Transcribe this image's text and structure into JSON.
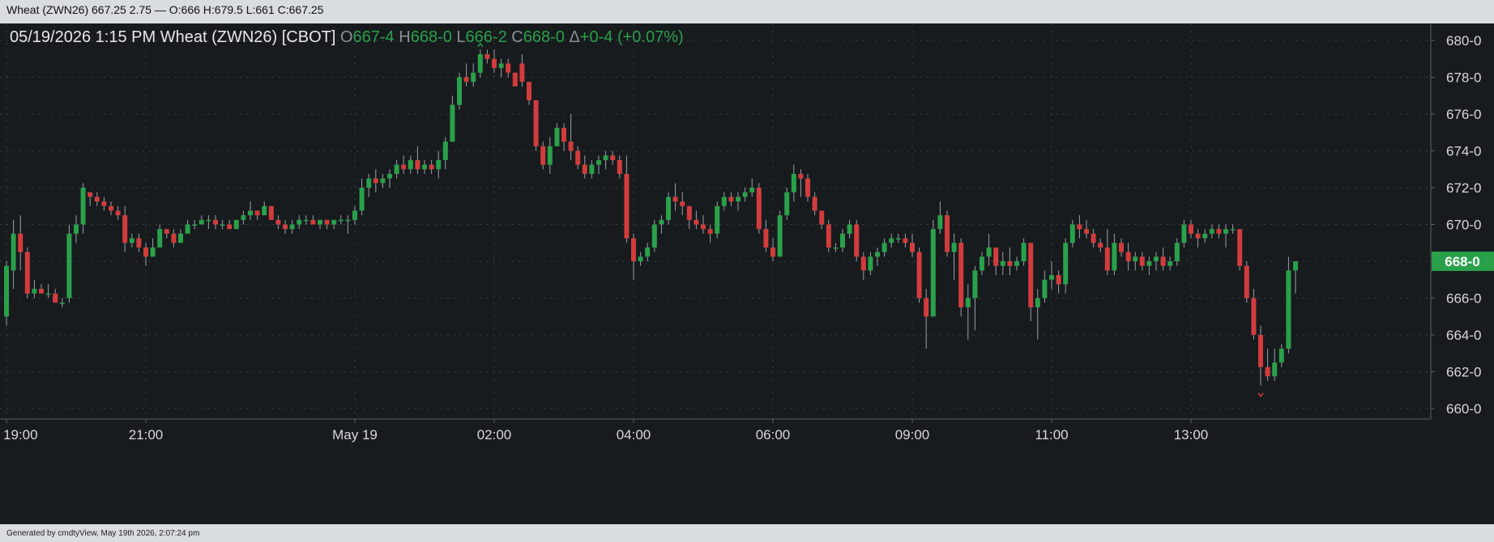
{
  "window": {
    "title": "Wheat (ZWN26) 667.25 2.75 — O:666 H:679.5 L:661 C:667.25"
  },
  "header": {
    "datetime": "05/19/2026  1:15 PM",
    "instrument": "Wheat (ZWN26) [CBOT]",
    "open_label": "O",
    "open_value": "667-4",
    "high_label": "H",
    "high_value": "668-0",
    "low_label": "L",
    "low_value": "666-2",
    "close_label": "C",
    "close_value": "668-0",
    "change_label": "Δ",
    "change_value": "+0-4 (+0.07%)"
  },
  "footer": {
    "text": "Generated by cmdtyView, May 19th 2026, 2:07:24 pm"
  },
  "colors": {
    "background": "#171b1e",
    "up": "#2aa04a",
    "down": "#d23c3c",
    "grid": "#3a3f44",
    "last_price_tag": "#2aa04a"
  },
  "chart_data": {
    "type": "candlestick",
    "title": "Wheat (ZWN26) [CBOT]",
    "interval": "15 min",
    "ylim": [
      659.5,
      681
    ],
    "y_ticks": [
      "680-0",
      "678-0",
      "676-0",
      "674-0",
      "672-0",
      "670-0",
      "668-0",
      "666-0",
      "664-0",
      "662-0",
      "660-0"
    ],
    "y_tick_values": [
      680,
      678,
      676,
      674,
      672,
      670,
      668,
      666,
      664,
      662,
      660
    ],
    "x_ticks": [
      "19:00",
      "21:00",
      "May 19",
      "02:00",
      "04:00",
      "06:00",
      "09:00",
      "11:00",
      "13:00"
    ],
    "x_tick_positions": [
      0,
      20,
      50,
      70,
      90,
      110,
      130,
      150,
      170
    ],
    "grid": true,
    "last_price": "668-0",
    "last_price_value": 668,
    "high_marker": 679.75,
    "low_marker": 660.75,
    "candles": [
      [
        665,
        668,
        664.5,
        667.75
      ],
      [
        667.5,
        670.25,
        666.5,
        669.5
      ],
      [
        669.5,
        670.5,
        667.5,
        668.5
      ],
      [
        668.5,
        668.75,
        666,
        666.25
      ],
      [
        666.25,
        667,
        666,
        666.5
      ],
      [
        666.5,
        666.75,
        666.25,
        666.25
      ],
      [
        666.25,
        666.75,
        666,
        666.25
      ],
      [
        666.25,
        666.5,
        665.75,
        665.75
      ],
      [
        665.75,
        666,
        665.5,
        665.75
      ],
      [
        666,
        670,
        665.75,
        669.5
      ],
      [
        669.5,
        670.5,
        669,
        670
      ],
      [
        670,
        672.25,
        669.5,
        672
      ],
      [
        671.75,
        671.75,
        671,
        671.5
      ],
      [
        671.5,
        671.75,
        671,
        671.25
      ],
      [
        671.25,
        671.5,
        670.75,
        671
      ],
      [
        671,
        671.25,
        670.5,
        670.75
      ],
      [
        670.75,
        671,
        670.25,
        670.5
      ],
      [
        670.5,
        671,
        668.5,
        669
      ],
      [
        669,
        669.5,
        668.75,
        669.25
      ],
      [
        669.25,
        669.5,
        668.5,
        668.75
      ],
      [
        668.75,
        669,
        667.75,
        668.25
      ],
      [
        668.25,
        669.25,
        668.25,
        668.75
      ],
      [
        668.75,
        670,
        668.75,
        669.75
      ],
      [
        669.75,
        669.75,
        669.25,
        669.5
      ],
      [
        669.5,
        669.75,
        668.75,
        669
      ],
      [
        669,
        669.75,
        669,
        669.5
      ],
      [
        669.5,
        670.25,
        669.5,
        670
      ],
      [
        670,
        670.25,
        669.75,
        670
      ],
      [
        670,
        670.5,
        670,
        670.25
      ],
      [
        670.25,
        670.5,
        669.75,
        670.25
      ],
      [
        670.25,
        670.5,
        669.75,
        670
      ],
      [
        670,
        670.25,
        669.75,
        670
      ],
      [
        670,
        670.25,
        669.75,
        669.75
      ],
      [
        669.75,
        670.25,
        669.75,
        670.25
      ],
      [
        670.25,
        670.75,
        670,
        670.5
      ],
      [
        670.5,
        671.25,
        670.25,
        670.75
      ],
      [
        670.75,
        670.75,
        670.25,
        670.5
      ],
      [
        670.5,
        671.25,
        670.5,
        671
      ],
      [
        671,
        671,
        670.25,
        670.25
      ],
      [
        670.25,
        670.5,
        669.75,
        670
      ],
      [
        670,
        670.25,
        669.5,
        669.75
      ],
      [
        669.75,
        670.25,
        669.5,
        670
      ],
      [
        670,
        670.5,
        669.75,
        670.25
      ],
      [
        670.25,
        670.5,
        670,
        670.25
      ],
      [
        670.25,
        670.5,
        670,
        670
      ],
      [
        670,
        670.25,
        669.75,
        670.25
      ],
      [
        670.25,
        670.25,
        669.75,
        670
      ],
      [
        670,
        670.25,
        669.75,
        670.25
      ],
      [
        670.25,
        670.5,
        670,
        670.25
      ],
      [
        670.25,
        670.5,
        669.5,
        670.25
      ],
      [
        670.25,
        671,
        670,
        670.75
      ],
      [
        670.75,
        672.5,
        670.5,
        672
      ],
      [
        672,
        672.75,
        671.5,
        672.5
      ],
      [
        672.5,
        673,
        671.75,
        672.25
      ],
      [
        672.25,
        672.75,
        672,
        672.5
      ],
      [
        672.5,
        673,
        672,
        672.75
      ],
      [
        672.75,
        673.5,
        672.5,
        673.25
      ],
      [
        673.25,
        673.75,
        672.75,
        673
      ],
      [
        673,
        673.75,
        672.75,
        673.5
      ],
      [
        673.5,
        674.25,
        672.75,
        673
      ],
      [
        673,
        673.5,
        672.75,
        673.25
      ],
      [
        673.25,
        673.5,
        672.75,
        673
      ],
      [
        673,
        674,
        672.5,
        673.5
      ],
      [
        673.5,
        674.75,
        673,
        674.5
      ],
      [
        674.5,
        677,
        674.5,
        676.5
      ],
      [
        676.5,
        678.25,
        676.25,
        678
      ],
      [
        678,
        678.75,
        677.5,
        677.75
      ],
      [
        677.75,
        678.75,
        677.5,
        678.25
      ],
      [
        678.25,
        679.5,
        678,
        679.25
      ],
      [
        679.25,
        679.5,
        678.75,
        679
      ],
      [
        679,
        679.5,
        678.25,
        678.5
      ],
      [
        678.5,
        679,
        678,
        678.75
      ],
      [
        678.75,
        679,
        678,
        678.25
      ],
      [
        678.25,
        678.25,
        677.5,
        677.5
      ],
      [
        678.75,
        679.25,
        677.5,
        677.75
      ],
      [
        677.75,
        677.75,
        676.5,
        676.75
      ],
      [
        676.75,
        676.75,
        674,
        674.25
      ],
      [
        674.25,
        674.5,
        673,
        673.25
      ],
      [
        673.25,
        674.75,
        672.75,
        674.25
      ],
      [
        674.25,
        675.5,
        674.25,
        675.25
      ],
      [
        675.25,
        675.5,
        674,
        674.5
      ],
      [
        674.5,
        676,
        673.5,
        674
      ],
      [
        674,
        674.25,
        673,
        673.25
      ],
      [
        673.25,
        673.75,
        672.5,
        672.75
      ],
      [
        672.75,
        673.5,
        672.5,
        673.25
      ],
      [
        673.25,
        673.75,
        672.75,
        673.5
      ],
      [
        673.5,
        674,
        673,
        673.75
      ],
      [
        673.75,
        674,
        673.25,
        673.5
      ],
      [
        673.5,
        673.75,
        672.5,
        672.75
      ],
      [
        672.75,
        673.75,
        669,
        669.25
      ],
      [
        669.25,
        669.5,
        667,
        668
      ],
      [
        668,
        668.5,
        667.75,
        668.25
      ],
      [
        668.25,
        669,
        668,
        668.75
      ],
      [
        668.75,
        670.25,
        668.5,
        670
      ],
      [
        670,
        670.5,
        669.5,
        670.25
      ],
      [
        670.25,
        671.75,
        670,
        671.5
      ],
      [
        671.5,
        672.25,
        670.75,
        671.25
      ],
      [
        671.25,
        671.75,
        670.5,
        671
      ],
      [
        671,
        671,
        669.75,
        670.25
      ],
      [
        670.25,
        670.75,
        669.75,
        670
      ],
      [
        670,
        670.5,
        669.5,
        669.75
      ],
      [
        669.75,
        670,
        669,
        669.5
      ],
      [
        669.5,
        671.25,
        669.25,
        671
      ],
      [
        671,
        671.75,
        670.75,
        671.5
      ],
      [
        671.5,
        671.75,
        671,
        671.25
      ],
      [
        671.25,
        671.75,
        670.75,
        671.5
      ],
      [
        671.5,
        672,
        671.25,
        671.75
      ],
      [
        671.75,
        672.5,
        671.5,
        672
      ],
      [
        672,
        672.25,
        669.5,
        669.75
      ],
      [
        669.75,
        670.25,
        668.5,
        668.75
      ],
      [
        668.75,
        669.25,
        668,
        668.25
      ],
      [
        668.25,
        670.75,
        668.25,
        670.5
      ],
      [
        670.5,
        672,
        670.25,
        671.75
      ],
      [
        671.75,
        673.25,
        671.25,
        672.75
      ],
      [
        672.75,
        673,
        671.5,
        672.5
      ],
      [
        672.5,
        672.75,
        671.25,
        671.5
      ],
      [
        671.5,
        671.75,
        670.5,
        670.75
      ],
      [
        670.75,
        670.75,
        669.75,
        670
      ],
      [
        670,
        670.25,
        668.5,
        668.75
      ],
      [
        668.75,
        669,
        668.5,
        668.75
      ],
      [
        668.75,
        669.75,
        668.5,
        669.5
      ],
      [
        669.5,
        670.25,
        669.25,
        670
      ],
      [
        670,
        670.25,
        668,
        668.25
      ],
      [
        668.25,
        668.5,
        667,
        667.5
      ],
      [
        667.5,
        668.5,
        667.25,
        668.25
      ],
      [
        668.25,
        668.75,
        667.75,
        668.5
      ],
      [
        668.5,
        669.25,
        668.25,
        669
      ],
      [
        669,
        669.5,
        668.75,
        669.25
      ],
      [
        669.25,
        669.5,
        669,
        669.25
      ],
      [
        669.25,
        669.5,
        668.75,
        669
      ],
      [
        669,
        669.5,
        668.25,
        668.5
      ],
      [
        668.5,
        668.75,
        665.75,
        666
      ],
      [
        666,
        666.5,
        663.25,
        665
      ],
      [
        665,
        670.25,
        665,
        669.75
      ],
      [
        669.75,
        671.25,
        669.5,
        670.5
      ],
      [
        670.5,
        670.75,
        668.25,
        668.5
      ],
      [
        668.5,
        669.5,
        667,
        669
      ],
      [
        669,
        669.25,
        665,
        665.5
      ],
      [
        665.5,
        666.75,
        663.75,
        666
      ],
      [
        666,
        667.75,
        664.25,
        667.5
      ],
      [
        667.5,
        668.5,
        667.25,
        668.25
      ],
      [
        668.25,
        669.5,
        667.75,
        668.75
      ],
      [
        668.75,
        668.75,
        667.25,
        667.75
      ],
      [
        667.75,
        668.5,
        667.25,
        668
      ],
      [
        668,
        668.75,
        667.25,
        667.75
      ],
      [
        667.75,
        668.25,
        667.5,
        668
      ],
      [
        668,
        669.25,
        667.75,
        669
      ],
      [
        669,
        669,
        664.75,
        665.5
      ],
      [
        665.5,
        666.5,
        663.75,
        666
      ],
      [
        666,
        667.5,
        665.75,
        667
      ],
      [
        667,
        668,
        666.5,
        667.25
      ],
      [
        667.25,
        667.5,
        666.25,
        666.75
      ],
      [
        666.75,
        669.25,
        666.25,
        669
      ],
      [
        669,
        670.25,
        668.75,
        670
      ],
      [
        670,
        670.5,
        669.25,
        669.75
      ],
      [
        669.75,
        670.25,
        669.25,
        669.5
      ],
      [
        669.5,
        669.75,
        668.75,
        669
      ],
      [
        669,
        669.25,
        668.5,
        668.75
      ],
      [
        668.75,
        669.75,
        667.25,
        667.5
      ],
      [
        667.5,
        669.5,
        667.25,
        669
      ],
      [
        669,
        669.25,
        668.25,
        668.5
      ],
      [
        668.5,
        669,
        667.5,
        668
      ],
      [
        668,
        668.5,
        667.5,
        668.25
      ],
      [
        668.25,
        668.5,
        667.5,
        667.75
      ],
      [
        667.75,
        668.25,
        667.25,
        668
      ],
      [
        668,
        668.5,
        667.5,
        668.25
      ],
      [
        668.25,
        668.75,
        667.5,
        667.75
      ],
      [
        667.75,
        668.25,
        667.5,
        668
      ],
      [
        668,
        669.25,
        667.75,
        669
      ],
      [
        669,
        670.25,
        668.75,
        670
      ],
      [
        670,
        670.25,
        669.25,
        669.5
      ],
      [
        669.5,
        669.75,
        668.75,
        669.25
      ],
      [
        669.25,
        669.75,
        669,
        669.5
      ],
      [
        669.5,
        670,
        669.25,
        669.75
      ],
      [
        669.75,
        670,
        669.25,
        669.5
      ],
      [
        669.5,
        670,
        668.75,
        669.75
      ],
      [
        669.75,
        670,
        669.5,
        669.75
      ],
      [
        669.75,
        669.75,
        667.5,
        667.75
      ],
      [
        667.75,
        668,
        665.75,
        666
      ],
      [
        666,
        666.5,
        663.75,
        664
      ],
      [
        664,
        664.5,
        661.25,
        662.25
      ],
      [
        662.25,
        663.25,
        661.5,
        661.75
      ],
      [
        661.75,
        663.25,
        661.5,
        662.5
      ],
      [
        662.5,
        663.5,
        662.25,
        663.25
      ],
      [
        663.25,
        668.25,
        663,
        667.5
      ],
      [
        667.5,
        668,
        666.25,
        668
      ]
    ]
  }
}
